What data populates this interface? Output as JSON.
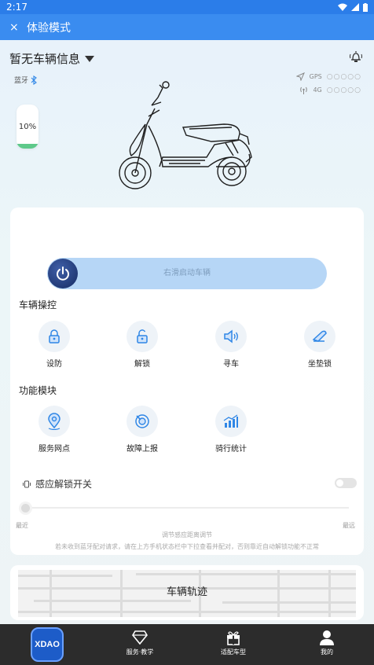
{
  "status_bar": {
    "time": "2:17"
  },
  "app_bar": {
    "close_symbol": "×",
    "title": "体验模式"
  },
  "vehicle": {
    "name": "暂无车辆信息"
  },
  "connectivity": {
    "bluetooth_label": "蓝牙",
    "gps_label": "GPS",
    "gps_strength": "○○○○○",
    "network_label": "4G",
    "network_strength": "○○○○○"
  },
  "battery": {
    "percent_label": "10%",
    "level": 0.1,
    "color": "#5ec98a"
  },
  "start_slider": {
    "hint": "右滑启动车辆"
  },
  "vehicle_control": {
    "title": "车辆操控",
    "items": [
      {
        "label": "设防",
        "icon": "lock-icon"
      },
      {
        "label": "解锁",
        "icon": "unlock-icon"
      },
      {
        "label": "寻车",
        "icon": "speaker-icon"
      },
      {
        "label": "坐垫锁",
        "icon": "seat-lock-icon"
      }
    ]
  },
  "function_modules": {
    "title": "功能模块",
    "items": [
      {
        "label": "服务网点",
        "icon": "location-pin-icon"
      },
      {
        "label": "故障上报",
        "icon": "fault-report-icon"
      },
      {
        "label": "骑行统计",
        "icon": "stats-chart-icon"
      }
    ]
  },
  "proximity_unlock": {
    "label": "感应解锁开关",
    "enabled": false,
    "range_min_label": "最近",
    "range_max_label": "最远",
    "caption": "调节感应距离调节",
    "hint": "若未收到蓝牙配对请求，请在上方手机状态栏中下拉查看并配对，否则靠近自动解锁功能不正常"
  },
  "track": {
    "label": "车辆轨迹"
  },
  "bottom_nav": {
    "logo_text": "XDAO",
    "items": [
      {
        "label": "服务·教学",
        "icon": "diamond-icon"
      },
      {
        "label": "适配车型",
        "icon": "gift-icon"
      },
      {
        "label": "我的",
        "icon": "person-icon"
      }
    ]
  },
  "colors": {
    "primary": "#3a8cf0",
    "status_bar": "#2b7de9",
    "icon_blue": "#2f86e6",
    "nav_bg": "#2c2c2c"
  }
}
